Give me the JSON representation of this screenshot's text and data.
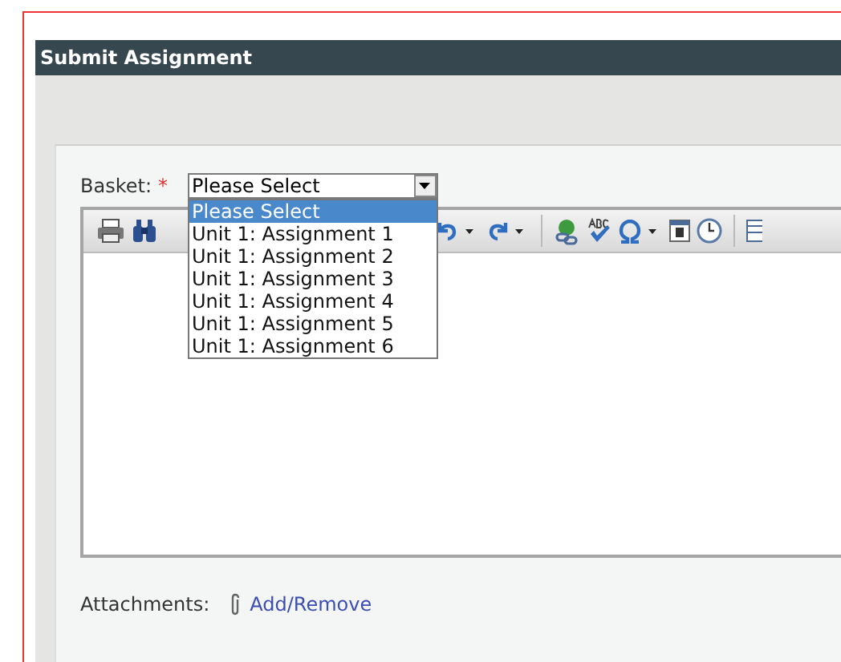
{
  "window": {
    "title": "Submit Assignment"
  },
  "basket": {
    "label": "Basket:",
    "required_mark": "*",
    "value": "Please Select",
    "expanded": true,
    "options": [
      {
        "label": "Please Select",
        "selected": true
      },
      {
        "label": "Unit 1: Assignment 1",
        "selected": false
      },
      {
        "label": "Unit 1: Assignment 2",
        "selected": false
      },
      {
        "label": "Unit 1: Assignment 3",
        "selected": false
      },
      {
        "label": "Unit 1: Assignment 4",
        "selected": false
      },
      {
        "label": "Unit 1: Assignment 5",
        "selected": false
      },
      {
        "label": "Unit 1: Assignment 6",
        "selected": false
      }
    ]
  },
  "attachments": {
    "label": "Attachments:",
    "link": "Add/Remove"
  }
}
